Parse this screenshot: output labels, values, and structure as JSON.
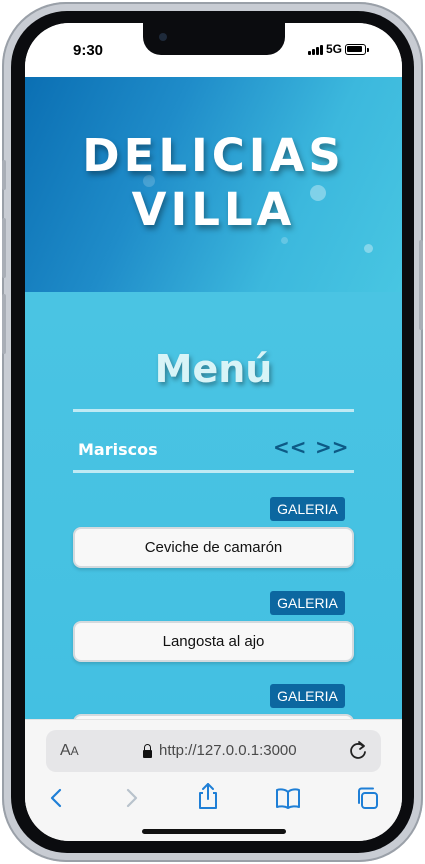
{
  "status_bar": {
    "time": "9:30",
    "network": "5G"
  },
  "hero": {
    "title_line1": "DELICIAS",
    "title_line2": "VILLA"
  },
  "menu": {
    "title": "Menú",
    "category": "Mariscos",
    "prev_label": "<<",
    "next_label": ">>",
    "gallery_label": "GALERIA",
    "items": [
      {
        "name": "Ceviche de camarón"
      },
      {
        "name": "Langosta al ajo"
      },
      {
        "name": ""
      }
    ]
  },
  "browser": {
    "text_size_label": "A",
    "text_size_label_small": "A",
    "url": "http://127.0.0.1:3000"
  },
  "colors": {
    "accent": "#0c67a0",
    "hero_gradient_start": "#0b6fb3",
    "menu_background": "#4ac4e3",
    "nav_blue": "#1f7fd6"
  }
}
